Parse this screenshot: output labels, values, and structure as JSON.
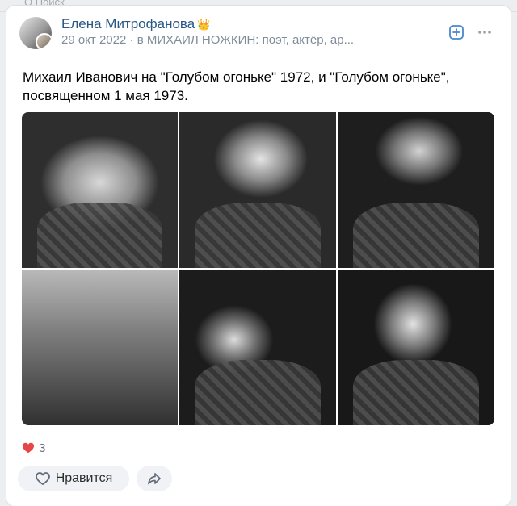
{
  "page_top": {
    "ghost_text": "Q Поиск"
  },
  "post": {
    "author": "Елена Митрофанова",
    "author_badge": "👑",
    "date": "29 окт 2022",
    "separator": "·",
    "location": "в МИХАИЛ НОЖКИН: поэт, актёр, ар...",
    "text": "Михаил Иванович на \"Голубом огоньке\" 1972, и \"Голубом огоньке\", посвященном 1 мая 1973.",
    "photos": [
      {
        "name": "photo-1",
        "icon": "photo"
      },
      {
        "name": "photo-2",
        "icon": "photo"
      },
      {
        "name": "photo-3",
        "icon": "photo"
      },
      {
        "name": "photo-4",
        "icon": "photo"
      },
      {
        "name": "photo-5",
        "icon": "photo"
      },
      {
        "name": "photo-6",
        "icon": "photo"
      }
    ],
    "likes_count": "3",
    "like_label": "Нравится"
  },
  "colors": {
    "link": "#2a5885",
    "accent": "#4986cc",
    "heart": "#e64646",
    "muted": "#818c99"
  },
  "icons": {
    "add": "plus-square-icon",
    "more": "more-dots-icon",
    "heart": "heart-icon",
    "share": "share-arrow-icon"
  }
}
